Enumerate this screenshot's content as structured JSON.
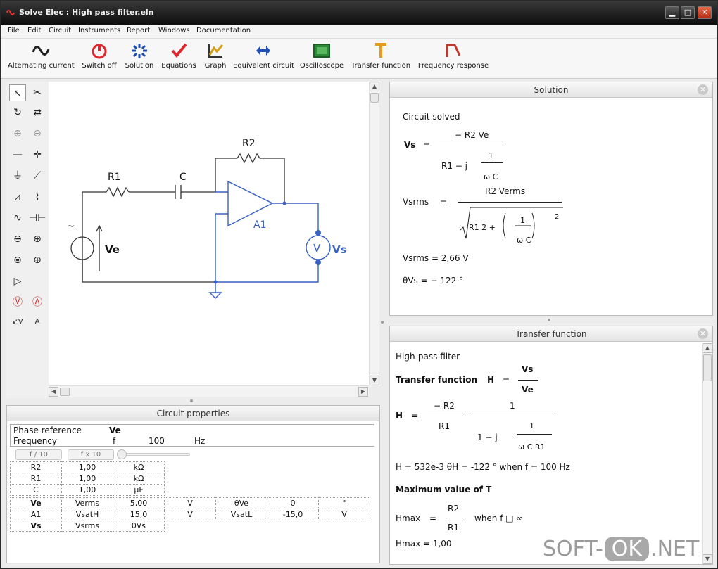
{
  "window": {
    "title": "Solve Elec : High pass filter.eln",
    "min": "▁",
    "max": "□",
    "close": "✕"
  },
  "menu": [
    "File",
    "Edit",
    "Circuit",
    "Instruments",
    "Report",
    "Windows",
    "Documentation"
  ],
  "toolbar": [
    {
      "icon": "sine-wave-icon",
      "label": "Alternating current",
      "color": "#222222"
    },
    {
      "icon": "power-icon",
      "label": "Switch off",
      "color": "#e0262e"
    },
    {
      "icon": "solution-spinner-icon",
      "label": "Solution",
      "color": "#1f4fb5"
    },
    {
      "icon": "checkmark-icon",
      "label": "Equations",
      "color": "#e0262e"
    },
    {
      "icon": "graph-icon",
      "label": "Graph",
      "color": "#d4a017"
    },
    {
      "icon": "equivalent-circuit-icon",
      "label": "Equivalent circuit",
      "color": "#1f4fb5"
    },
    {
      "icon": "oscilloscope-icon",
      "label": "Oscilloscope",
      "color": "#2c8a3a"
    },
    {
      "icon": "transfer-function-icon",
      "label": "Transfer function",
      "color": "#e79a1c"
    },
    {
      "icon": "frequency-response-icon",
      "label": "Frequency response",
      "color": "#c0392b"
    }
  ],
  "circuit": {
    "r1": "R1",
    "c": "C",
    "r2": "R2",
    "a1": "A1",
    "ve": "Ve",
    "vs": "Vs",
    "v": "V",
    "src": "~"
  },
  "properties": {
    "title": "Circuit properties",
    "phase_label": "Phase reference",
    "phase_value": "Ve",
    "freq_label": "Frequency",
    "freq_symbol": "f",
    "freq_value": "100",
    "freq_unit": "Hz",
    "btn_div": "f / 10",
    "btn_mul": "f x 10",
    "rows": [
      [
        "R2",
        "1,00",
        "kΩ"
      ],
      [
        "R1",
        "1,00",
        "kΩ"
      ],
      [
        "C",
        "1,00",
        "µF"
      ],
      [
        "Ve",
        "Verms",
        "5,00",
        "V",
        "θVe",
        "0",
        "°"
      ],
      [
        "A1",
        "VsatH",
        "15,0",
        "V",
        "VsatL",
        "-15,0",
        "V"
      ],
      [
        "Vs",
        "Vsrms",
        "θVs"
      ]
    ]
  },
  "solution": {
    "title": "Solution",
    "solved": "Circuit solved",
    "vs": "Vs",
    "eq": "=",
    "num1": "− R2 Ve",
    "den1a": "R1  − j",
    "one": "1",
    "omegaC": "ω C",
    "vsrms": "Vsrms",
    "num2": "R2 Verms",
    "den2": "R1 2 +",
    "sq": "2",
    "vsrms_val": "Vsrms  =  2,66  V",
    "theta_val": "θVs  =   − 122  °"
  },
  "transfer": {
    "title": "Transfer function",
    "type": "High-pass filter",
    "tf_label": "Transfer function",
    "h": "H",
    "vs": "Vs",
    "ve": "Ve",
    "mr2": "−  R2",
    "r1": "R1",
    "one": "1",
    "den": "1   −   j",
    "omegaCR": "ω C R1",
    "values": "H = 532e-3   θH = -122 °   when f = 100 Hz",
    "max_label": "Maximum value of T",
    "hmax": "Hmax",
    "r2": "R2",
    "when": "when    f   □  ∞",
    "hmax_val": "Hmax  =  1,00"
  },
  "watermark": {
    "a": "SOFT-",
    "b": "OK",
    "c": ".NET"
  }
}
